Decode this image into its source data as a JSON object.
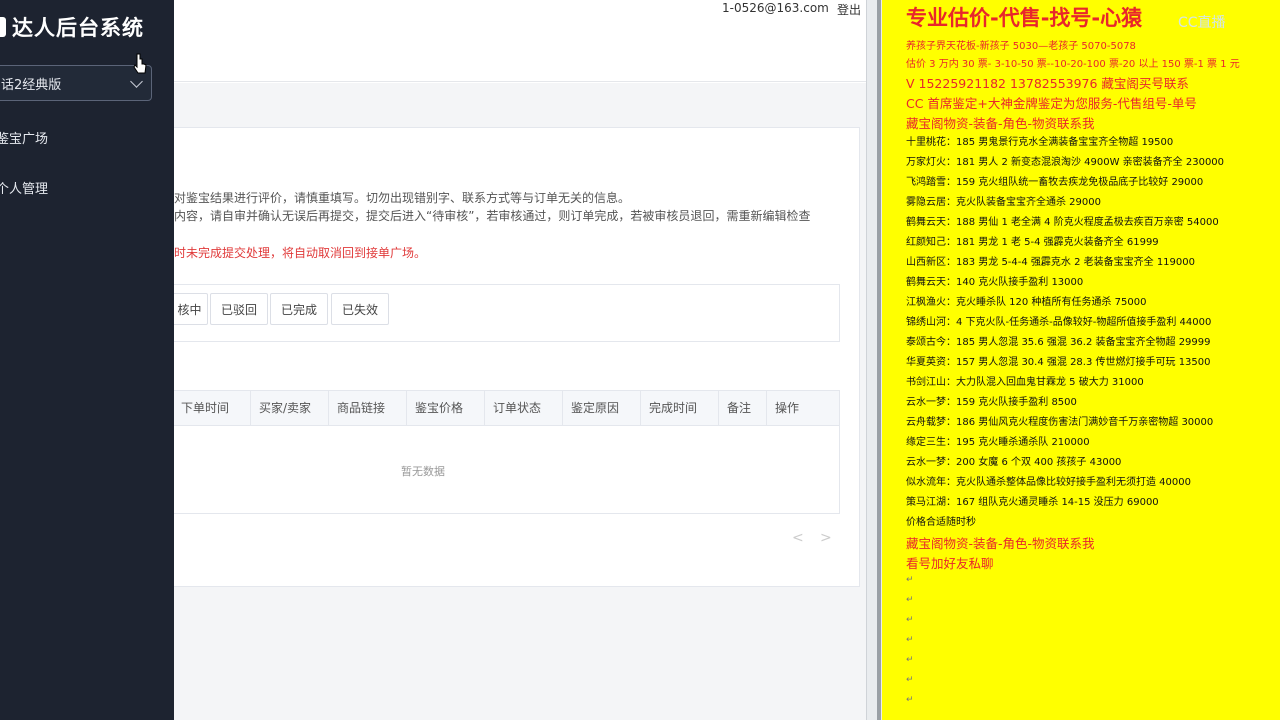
{
  "sidebar": {
    "app_title": "达人后台系统",
    "game_select": "话2经典版",
    "nav": [
      "鉴宝广场",
      "个人管理"
    ]
  },
  "header": {
    "email": "1-0526@163.com",
    "logout": "登出"
  },
  "notices": {
    "line1": "对鉴宝结果进行评价，请慎重填写。切勿出现错别字、联系方式等与订单无关的信息。",
    "line2": "内容，请自审并确认无误后再提交，提交后进入“待审核”，若审核通过，则订单完成，若被审核员退回，需重新编辑检查",
    "line3": "时未完成提交处理，将自动取消回到接单广场。"
  },
  "status_tabs": [
    "核中",
    "已驳回",
    "已完成",
    "已失效"
  ],
  "table": {
    "columns": [
      "下单时间",
      "买家/卖家",
      "商品链接",
      "鉴宝价格",
      "订单状态",
      "鉴定原因",
      "完成时间",
      "备注",
      "操作"
    ],
    "empty_text": "暂无数据"
  },
  "pager": {
    "prev": "<",
    "next": ">"
  },
  "ad": {
    "title": "专业估价-代售-找号-心猿",
    "watermark": "CC直播",
    "lines": [
      {
        "style": "sm-red",
        "text": "养孩子界天花板-新孩子 5030—老孩子 5070-5078"
      },
      {
        "style": "sm-red",
        "text": "估价 3 万内 30 票- 3-10-50 票--10-20-100 票-20 以上 150 票-1 票 1 元"
      },
      {
        "style": "red",
        "text": "V 15225921182      13782553976    藏宝阁买号联系"
      },
      {
        "style": "red",
        "text": "CC 首席鉴定+大神金牌鉴定为您服务-代售组号-单号"
      },
      {
        "style": "red",
        "text": "藏宝阁物资-装备-角色-物资联系我"
      },
      {
        "style": "black",
        "text": "十里桃花：185 男鬼景行克水全满装备宝宝齐全物超 19500"
      },
      {
        "style": "black",
        "text": "万家灯火：181 男人 2 新变态混浪淘沙 4900W 亲密装备齐全 230000"
      },
      {
        "style": "black",
        "text": "飞鸿踏雪：159 克火组队统一畜牧去疾龙免极品底子比较好 29000"
      },
      {
        "style": "black",
        "text": "雾隐云居：克火队装备宝宝齐全通杀 29000"
      },
      {
        "style": "black",
        "text": "鹤舞云天：188 男仙 1 老全满 4 阶克火程度孟极去疾百万亲密 54000"
      },
      {
        "style": "black",
        "text": "红颜知己：181 男龙 1 老 5-4 强霹克火装备齐全 61999"
      },
      {
        "style": "black",
        "text": "山西新区：183 男龙 5-4-4 强霹克水 2 老装备宝宝齐全 119000"
      },
      {
        "style": "black",
        "text": "鹤舞云天：140 克火队接手盈利 13000"
      },
      {
        "style": "black",
        "text": "江枫渔火：克火睡杀队 120 种植所有任务通杀 75000"
      },
      {
        "style": "black",
        "text": "锦绣山河：4 下克火队-任务通杀-品像较好-物超所值接手盈利 44000"
      },
      {
        "style": "black",
        "text": "泰颂古今：185 男人忽混 35.6 强混 36.2 装备宝宝齐全物超 29999"
      },
      {
        "style": "black",
        "text": "华夏英资：157 男人忽混 30.4 强混 28.3 传世燃灯接手可玩 13500"
      },
      {
        "style": "black",
        "text": "书剑江山：大力队混入回血鬼甘霖龙 5 破大力 31000"
      },
      {
        "style": "black",
        "text": "云水一梦：159 克火队接手盈利 8500"
      },
      {
        "style": "black",
        "text": "云舟载梦：186 男仙风克火程度伤害法门满妙音千万亲密物超 30000"
      },
      {
        "style": "black",
        "text": "缘定三生：195 克火睡杀通杀队 210000"
      },
      {
        "style": "black",
        "text": "云水一梦：200 女魔 6 个双 400 孩孩子 43000"
      },
      {
        "style": "black",
        "text": "似水流年：克火队通杀整体品像比较好接手盈利无须打造 40000"
      },
      {
        "style": "black",
        "text": "策马江湖：167 组队克火通灵睡杀 14-15 没压力 69000"
      },
      {
        "style": "black",
        "text": "价格合适随时秒"
      },
      {
        "style": "red",
        "text": "藏宝阁物资-装备-角色-物资联系我"
      },
      {
        "style": "red",
        "text": "看号加好友私聊"
      }
    ],
    "para_mark": "↵"
  }
}
